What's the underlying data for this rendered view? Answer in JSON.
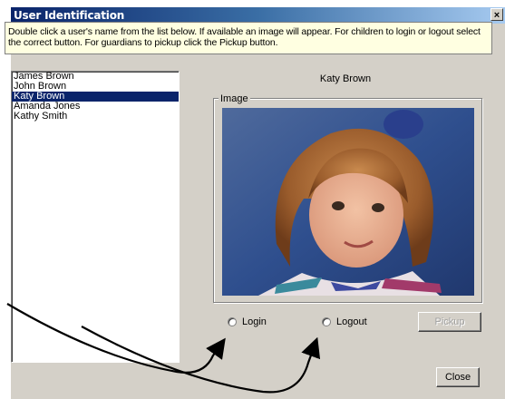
{
  "window": {
    "title": "User Identification",
    "close_glyph": "×"
  },
  "instructions": "Double click a user's name from the list below. If available an image will appear. For children to login or logout select the correct button. For guardians to pickup click the Pickup button.",
  "users": [
    "James Brown",
    "John Brown",
    "Katy Brown",
    "Amanda Jones",
    "Kathy Smith"
  ],
  "selected_index": 2,
  "selected_name": "Katy Brown",
  "image_group_label": "Image",
  "radios": {
    "login": "Login",
    "logout": "Logout"
  },
  "buttons": {
    "pickup": "Pickup",
    "close": "Close"
  },
  "colors": {
    "selection": "#0a246a",
    "tooltip_bg": "#ffffe1",
    "face": "#d4d0c8"
  }
}
